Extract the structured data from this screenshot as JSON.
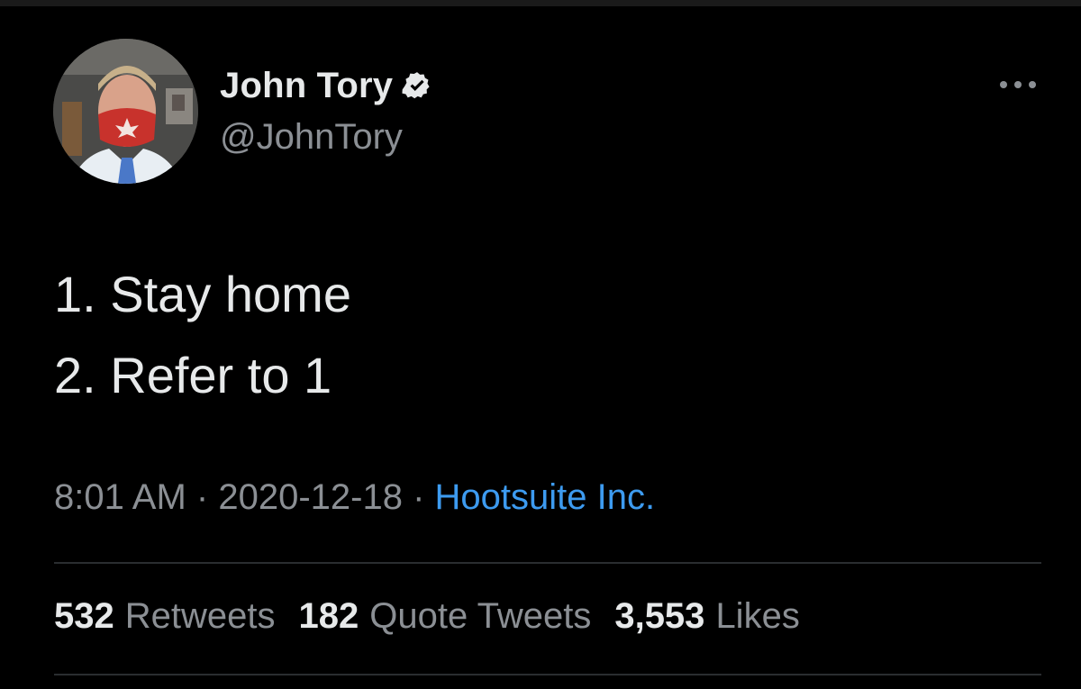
{
  "tweet": {
    "author": {
      "display_name": "John Tory",
      "handle": "@JohnTory",
      "verified": true,
      "avatar_icon": "profile-photo"
    },
    "text_lines": [
      "1. Stay home",
      "2. Refer to 1"
    ],
    "meta": {
      "time": "8:01 AM",
      "separator": "·",
      "date": "2020-12-18",
      "source": "Hootsuite Inc."
    },
    "stats": [
      {
        "count": "532",
        "label": "Retweets"
      },
      {
        "count": "182",
        "label": "Quote Tweets"
      },
      {
        "count": "3,553",
        "label": "Likes"
      }
    ],
    "more_icon": "more-horizontal-icon"
  },
  "colors": {
    "background": "#000000",
    "primary_text": "#e7e9ea",
    "secondary_text": "#8b8f94",
    "link": "#3d9bf0",
    "divider": "#2a2d30",
    "mask_red": "#c8322c"
  }
}
